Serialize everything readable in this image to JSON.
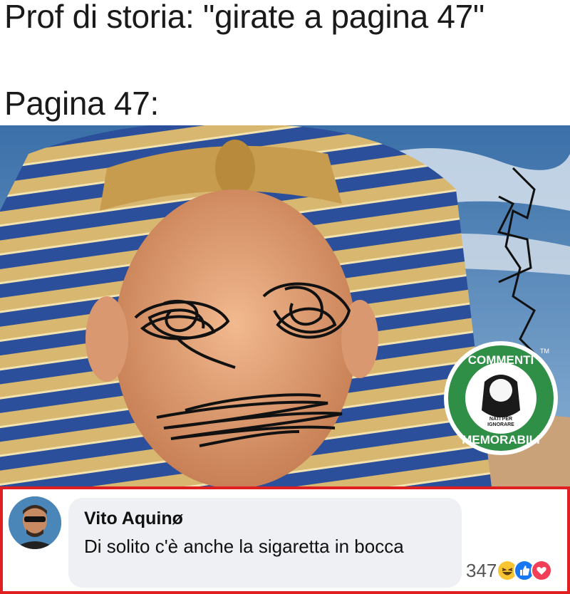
{
  "caption": {
    "line1": "Prof di storia: \"girate a pagina 47\"",
    "line2": "Pagina 47:"
  },
  "image": {
    "watermark": {
      "top_text": "COMMENTI",
      "bottom_text": "MEMORABILI",
      "small_text_line1": "NATI PER",
      "small_text_line2": "IGNORARE",
      "trademark": "TM",
      "color": "#2f8f46"
    },
    "headdress_colors": {
      "gold": "#d8b870",
      "blue": "#2b4f9a"
    }
  },
  "comment": {
    "author": "Vito Aquinø",
    "text": "Di solito c'è anche la sigaretta in bocca",
    "reaction_count": "347",
    "reactions": [
      "haha-icon",
      "like-icon",
      "love-icon"
    ]
  },
  "colors": {
    "highlight_border": "#e02020",
    "bubble_bg": "#eef0f3"
  }
}
